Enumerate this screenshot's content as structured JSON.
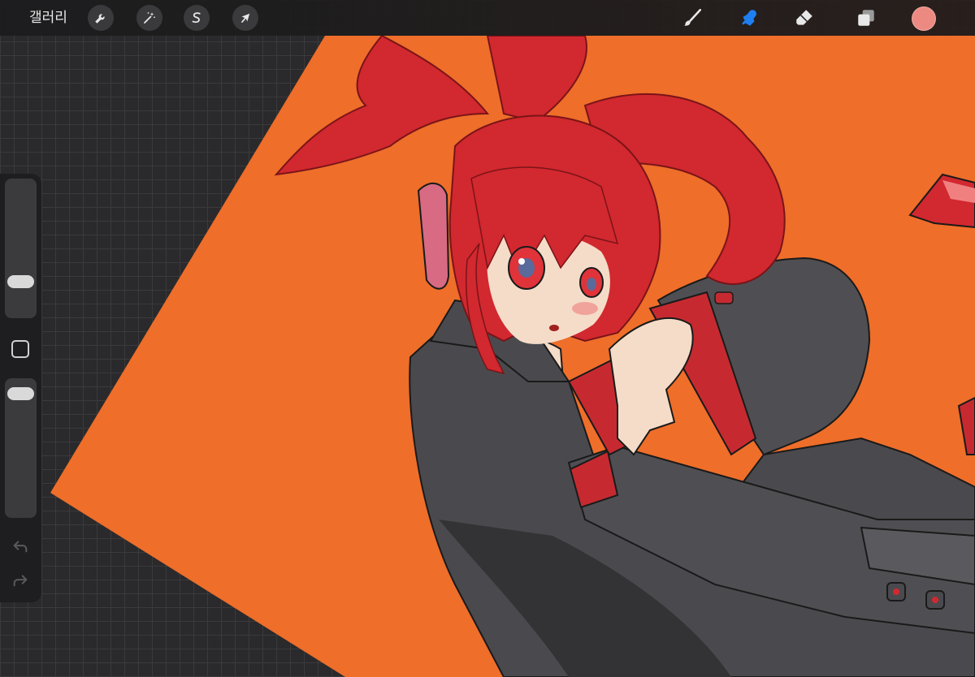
{
  "topbar": {
    "gallery_label": "갤러리",
    "left_tools": [
      {
        "icon": "wrench-icon",
        "name": "actions"
      },
      {
        "icon": "magic-wand-icon",
        "name": "adjustments"
      },
      {
        "icon": "selection-icon",
        "name": "selection"
      },
      {
        "icon": "arrow-cursor-icon",
        "name": "transform"
      }
    ],
    "right_tools": [
      {
        "icon": "brush-icon",
        "name": "paint"
      },
      {
        "icon": "smudge-icon",
        "name": "smudge",
        "active": true
      },
      {
        "icon": "eraser-icon",
        "name": "erase"
      },
      {
        "icon": "layers-icon",
        "name": "layers"
      }
    ],
    "current_color": "#ec8a82"
  },
  "sidebar": {
    "brush_size_level": 0.22,
    "opacity_level": 0.95,
    "undo_icon": "undo-icon",
    "redo_icon": "redo-icon"
  },
  "colors": {
    "accent_active": "#1d7ff0",
    "background_orange": "#ee6e2a",
    "hair_red": "#d2282f",
    "clothing_gray": "#4a4a4e"
  }
}
